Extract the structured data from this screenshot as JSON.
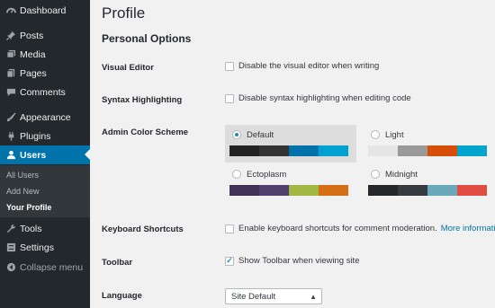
{
  "sidebar": {
    "items": [
      {
        "label": "Dashboard",
        "icon": "dashboard-icon"
      },
      {
        "label": "Posts",
        "icon": "pin-icon"
      },
      {
        "label": "Media",
        "icon": "media-icon"
      },
      {
        "label": "Pages",
        "icon": "page-icon"
      },
      {
        "label": "Comments",
        "icon": "comment-icon"
      },
      {
        "label": "Appearance",
        "icon": "brush-icon"
      },
      {
        "label": "Plugins",
        "icon": "plug-icon"
      },
      {
        "label": "Users",
        "icon": "user-icon"
      },
      {
        "label": "Tools",
        "icon": "wrench-icon"
      },
      {
        "label": "Settings",
        "icon": "settings-icon"
      },
      {
        "label": "Collapse menu",
        "icon": "collapse-icon"
      }
    ],
    "submenu": [
      "All Users",
      "Add New",
      "Your Profile"
    ],
    "active_color": "#0073aa"
  },
  "main": {
    "title": "Profile",
    "section": "Personal Options",
    "visual_editor": {
      "label": "Visual Editor",
      "option": "Disable the visual editor when writing",
      "checked": false
    },
    "syntax": {
      "label": "Syntax Highlighting",
      "option": "Disable syntax highlighting when editing code",
      "checked": false
    },
    "color_scheme": {
      "label": "Admin Color Scheme",
      "selected": "Default",
      "schemes": [
        {
          "name": "Default",
          "colors": [
            "#222222",
            "#333333",
            "#0073aa",
            "#00a0d2"
          ]
        },
        {
          "name": "Light",
          "colors": [
            "#e5e5e5",
            "#999999",
            "#d64e07",
            "#04a4cc"
          ]
        },
        {
          "name": "Ectoplasm",
          "colors": [
            "#413256",
            "#523f6d",
            "#a3b745",
            "#d46f15"
          ]
        },
        {
          "name": "Midnight",
          "colors": [
            "#25282b",
            "#363b3f",
            "#69a8bb",
            "#e14d43"
          ]
        }
      ]
    },
    "shortcuts": {
      "label": "Keyboard Shortcuts",
      "option": "Enable keyboard shortcuts for comment moderation.",
      "link": "More information",
      "checked": false
    },
    "toolbar": {
      "label": "Toolbar",
      "option": "Show Toolbar when viewing site",
      "checked": true
    },
    "language": {
      "label": "Language",
      "value": "Site Default"
    }
  }
}
